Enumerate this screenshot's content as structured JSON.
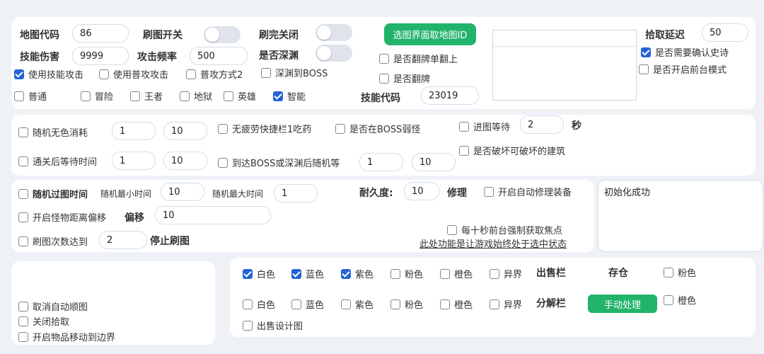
{
  "panel1": {
    "map_code_label": "地图代码",
    "map_code_value": "86",
    "skill_damage_label": "技能伤害",
    "skill_damage_value": "9999",
    "brush_switch_label": "刷图开关",
    "attack_freq_label": "攻击频率",
    "attack_freq_value": "500",
    "close_after_label": "刷完关闭",
    "deep_abyss_label": "是否深渊",
    "select_map_button": "选图界面取地图ID",
    "flip_single_label": "是否翻牌单翻上",
    "flip_card_label": "是否翻牌",
    "use_skill_attack": "使用技能攻击",
    "use_normal_attack": "使用普攻攻击",
    "normal_attack_mode2": "普攻方式2",
    "abyss_to_boss": "深渊到BOSS",
    "difficulties": [
      "普通",
      "冒险",
      "王者",
      "地狱",
      "英雄",
      "智能"
    ],
    "skill_code_label": "技能代码",
    "skill_code_value": "23019",
    "pickup_delay_label": "拾取延迟",
    "pickup_delay_value": "50",
    "confirm_epic_label": "是否需要确认史诗",
    "foreground_mode_label": "是否开启前台模式"
  },
  "panel2": {
    "random_no_color_label": "随机无色消耗",
    "random_no_color_min": "1",
    "random_no_color_max": "10",
    "no_fatigue_potion": "无疲劳快捷栏1吃药",
    "boss_weak": "是否在BOSS弱怪",
    "enter_wait_label": "进图等待",
    "enter_wait_value": "2",
    "enter_wait_unit": "秒",
    "clear_wait_label": "通关后等待时间",
    "clear_wait_min": "1",
    "clear_wait_max": "10",
    "reach_boss_wait_label": "到达BOSS或深渊后随机等",
    "reach_boss_wait_min": "1",
    "reach_boss_wait_max": "10",
    "destroy_buildings": "是否破坏可破坏的建筑"
  },
  "panel3": {
    "random_pass_time": "随机过图时间",
    "random_min_label": "随机最小时间",
    "random_min_value": "10",
    "random_max_label": "随机最大时间",
    "random_max_value": "1",
    "durability_label": "耐久度:",
    "durability_value": "10",
    "repair_label": "修理",
    "auto_repair": "开启自动修理装备",
    "monster_offset": "开启怪物距离偏移",
    "offset_label": "偏移",
    "offset_value": "10",
    "count_reached": "刷图次数达到",
    "count_value": "2",
    "stop_label": "停止刷图",
    "focus_every_10s": "每十秒前台强制获取焦点",
    "focus_note": "此处功能是让游戏始终处于选中状态"
  },
  "log": {
    "text": "初始化成功"
  },
  "panel4": {
    "cancel_auto_route": "取消自动顺图",
    "close_pickup": "关闭拾取",
    "move_items_edge": "开启物品移动到边界"
  },
  "panel5": {
    "sell_colors": [
      "白色",
      "蓝色",
      "紫色",
      "粉色",
      "橙色",
      "异界"
    ],
    "sell_label": "出售栏",
    "store_label": "存仓",
    "store_pink": "粉色",
    "dismantle_colors": [
      "白色",
      "蓝色",
      "紫色",
      "粉色",
      "橙色",
      "异界"
    ],
    "dismantle_label": "分解栏",
    "manual_button": "手动处理",
    "store_orange": "橙色",
    "sell_design": "出售设计图"
  },
  "colors": {
    "accent": "#2563d6",
    "green_button": "#22b36b",
    "background": "#eef2f7"
  }
}
